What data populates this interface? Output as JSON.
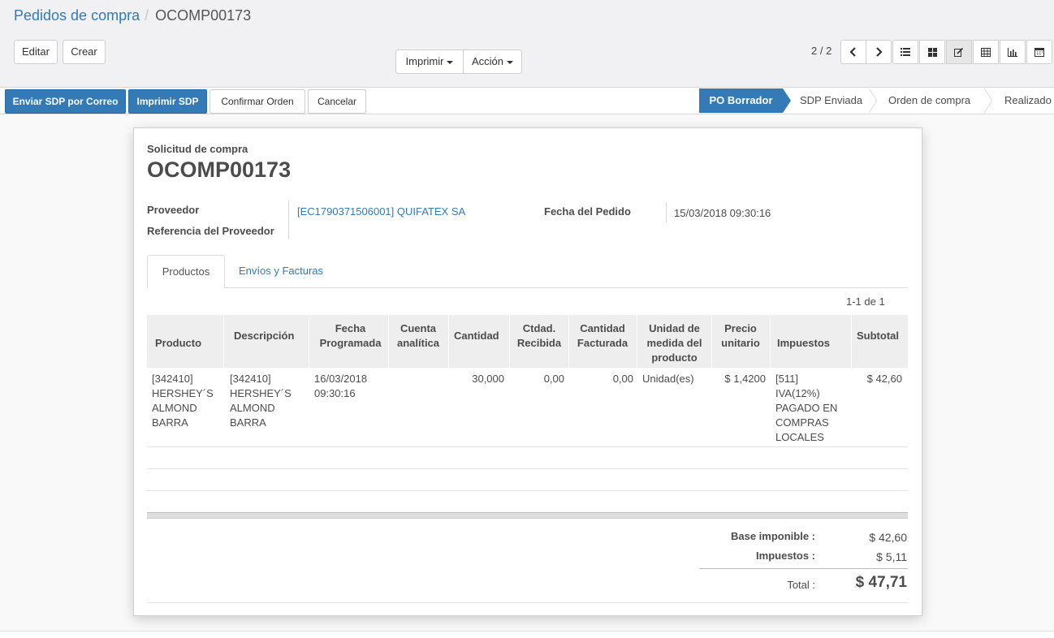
{
  "breadcrumb": {
    "parent": "Pedidos de compra",
    "separator": "/",
    "current": "OCOMP00173"
  },
  "buttons": {
    "edit": "Editar",
    "create": "Crear",
    "print": "Imprimir",
    "action": "Acción"
  },
  "pager": {
    "value": "2 / 2"
  },
  "views": [
    "list-view-icon",
    "kanban-view-icon",
    "form-view-icon",
    "pivot-view-icon",
    "graph-view-icon",
    "calendar-view-icon"
  ],
  "statusbar": {
    "send_rfq": "Enviar SDP por Correo",
    "print_rfq": "Imprimir SDP",
    "confirm": "Confirmar Orden",
    "cancel": "Cancelar",
    "stages": [
      "PO Borrador",
      "SDP Enviada",
      "Orden de compra",
      "Realizado"
    ],
    "active_stage": "PO Borrador"
  },
  "form": {
    "subtitle": "Solicitud de compra",
    "title": "OCOMP00173",
    "vendor_label": "Proveedor",
    "vendor_value": "[EC1790371506001] QUIFATEX SA",
    "vendor_ref_label": "Referencia del Proveedor",
    "vendor_ref_value": "",
    "order_date_label": "Fecha del Pedido",
    "order_date_value": "15/03/2018 09:30:16"
  },
  "tabs": [
    "Productos",
    "Envíos y Facturas"
  ],
  "table": {
    "pager": "1-1 de 1",
    "headers": {
      "product": "Producto",
      "description": "Descripción",
      "scheduled_1": "Fecha",
      "scheduled_2": "Programada",
      "analytic_1": "Cuenta",
      "analytic_2": "analítica",
      "qty": "Cantidad",
      "received_1": "Ctdad.",
      "received_2": "Recibida",
      "invoiced_1": "Cantidad",
      "invoiced_2": "Facturada",
      "uom_1": "Unidad de",
      "uom_2": "medida del",
      "uom_3": "producto",
      "price_1": "Precio",
      "price_2": "unitario",
      "taxes": "Impuestos",
      "subtotal": "Subtotal"
    },
    "row": {
      "product": [
        "[342410]",
        "HERSHEY´S",
        "ALMOND",
        "BARRA"
      ],
      "description": [
        "[342410]",
        "HERSHEY´S",
        "ALMOND",
        "BARRA"
      ],
      "scheduled": [
        "16/03/2018",
        "09:30:16"
      ],
      "analytic": "",
      "qty": "30,000",
      "received": "0,00",
      "invoiced": "0,00",
      "uom": "Unidad(es)",
      "price": "$ 1,4200",
      "taxes": [
        "[511]",
        "IVA(12%)",
        "PAGADO EN",
        "COMPRAS",
        "LOCALES"
      ],
      "subtotal": "$ 42,60"
    }
  },
  "totals": {
    "base_label": "Base imponible :",
    "base_value": "$ 42,60",
    "tax_label": "Impuestos :",
    "tax_value": "$ 5,11",
    "total_label": "Total :",
    "total_value": "$ 47,71"
  }
}
